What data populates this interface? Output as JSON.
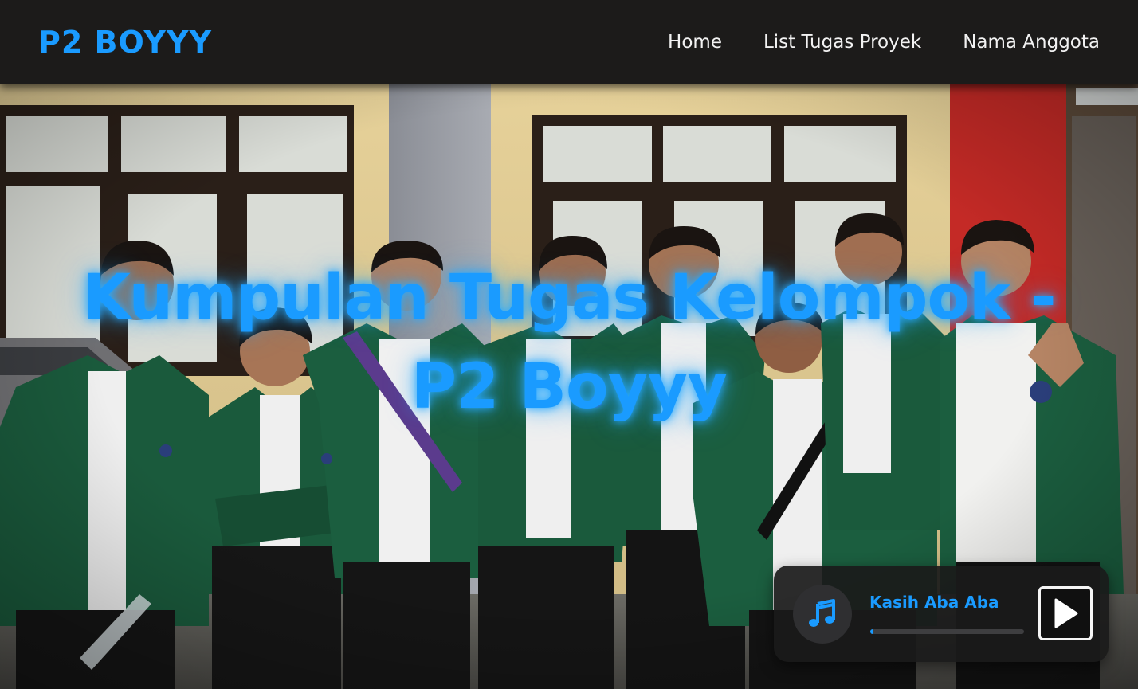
{
  "brand": "P2 BOYYY",
  "nav": {
    "items": [
      {
        "label": "Home"
      },
      {
        "label": "List Tugas Proyek"
      },
      {
        "label": "Nama Anggota"
      }
    ]
  },
  "hero": {
    "title": "Kumpulan Tugas Kelompok - P2 Boyyy",
    "image_subject": "group photo of eight students in green blazers in front of a building"
  },
  "player": {
    "song_title": "Kasih Aba Aba",
    "progress": 0.02,
    "icon": "music-note-icon",
    "play_icon": "play-icon"
  },
  "colors": {
    "accent": "#1a9bff",
    "navbar_bg": "#1c1b1a",
    "nav_text": "#f2f2f2",
    "blazer_green": "#1a5a3c"
  }
}
